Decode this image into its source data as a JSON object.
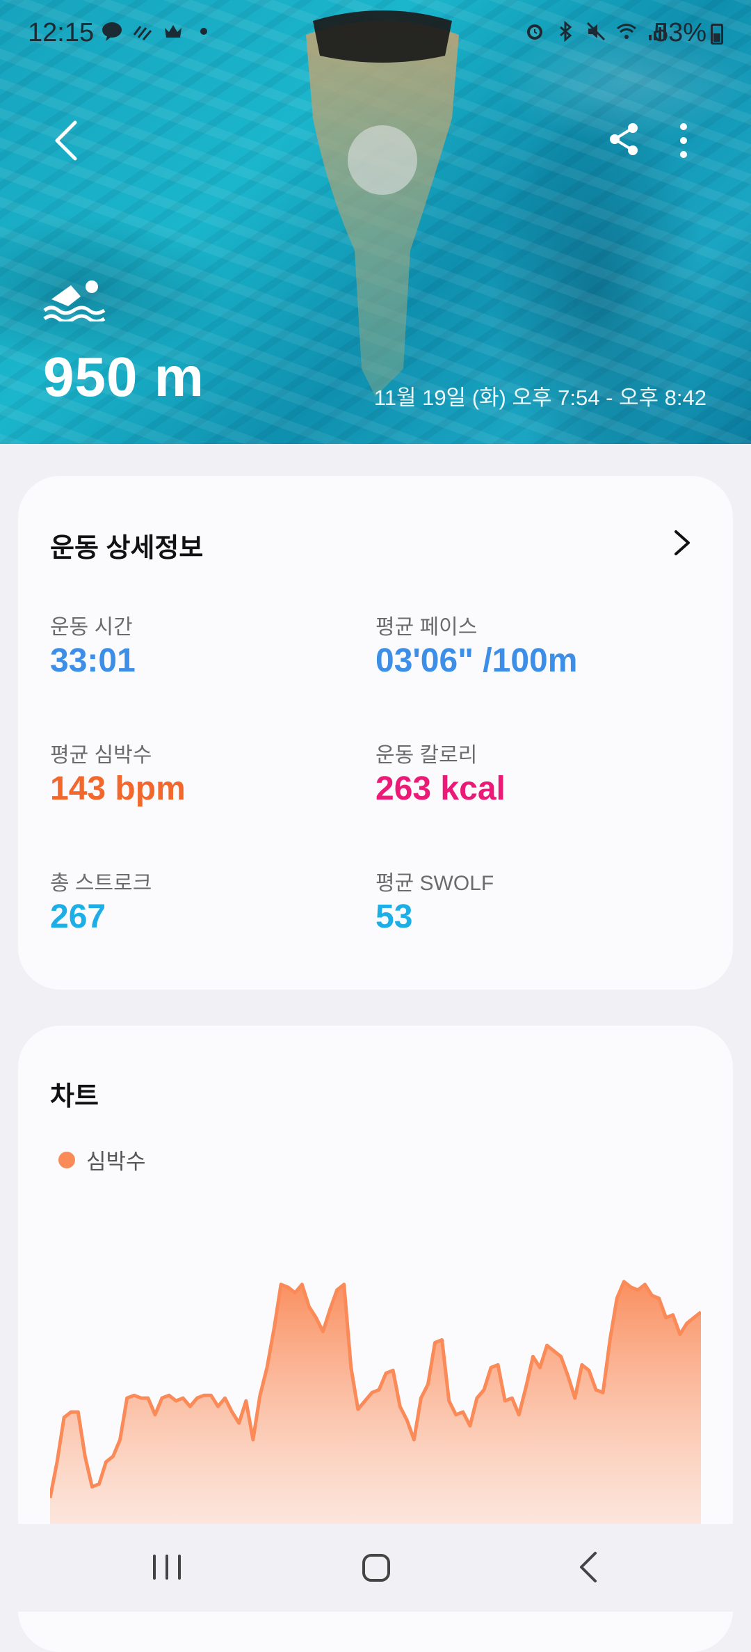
{
  "status_bar": {
    "time": "12:15",
    "battery": "53%",
    "left_icons": [
      "talk-icon",
      "signal-strokes-icon",
      "crown-icon",
      "dot-icon"
    ],
    "right_icons": [
      "alarm-icon",
      "bluetooth-icon",
      "mute-icon",
      "wifi-icon",
      "cell-signal-icon",
      "battery-icon"
    ]
  },
  "hero": {
    "distance": "950 m",
    "date_range": "11월 19일 (화) 오후 7:54 - 오후 8:42",
    "activity_icon": "swimming-icon"
  },
  "details": {
    "title": "운동 상세정보",
    "stats": [
      {
        "label": "운동 시간",
        "value": "33:01",
        "color": "#3d8ee6"
      },
      {
        "label": "평균 페이스",
        "value": "03'06\" /100m",
        "color": "#3d8ee6"
      },
      {
        "label": "평균 심박수",
        "value": "143 bpm",
        "color": "#f2682c"
      },
      {
        "label": "운동 칼로리",
        "value": "263 kcal",
        "color": "#ea1a76"
      },
      {
        "label": "총 스트로크",
        "value": "267",
        "color": "#1eaee6"
      },
      {
        "label": "평균 SWOLF",
        "value": "53",
        "color": "#1eaee6"
      }
    ]
  },
  "chart_section": {
    "title": "차트",
    "legend": "심박수"
  },
  "chart_data": {
    "type": "area",
    "series": [
      {
        "name": "심박수",
        "color": "#fa8a58",
        "values": [
          95,
          108,
          124,
          126,
          126,
          110,
          99,
          100,
          108,
          110,
          116,
          131,
          132,
          131,
          131,
          125,
          131,
          132,
          130,
          131,
          128,
          131,
          132,
          132,
          128,
          131,
          126,
          122,
          130,
          116,
          132,
          142,
          156,
          172,
          171,
          169,
          172,
          164,
          160,
          155,
          163,
          170,
          172,
          142,
          127,
          130,
          133,
          134,
          140,
          141,
          128,
          123,
          116,
          131,
          136,
          151,
          152,
          130,
          125,
          126,
          121,
          131,
          134,
          142,
          143,
          130,
          131,
          125,
          135,
          146,
          142,
          150,
          148,
          146,
          139,
          131,
          143,
          141,
          134,
          133,
          152,
          167,
          173,
          171,
          170,
          172,
          168,
          167,
          160,
          161,
          154,
          158,
          160,
          162
        ]
      }
    ]
  },
  "nav_bar": {
    "buttons": [
      "recents-icon",
      "home-icon",
      "back-icon"
    ]
  }
}
